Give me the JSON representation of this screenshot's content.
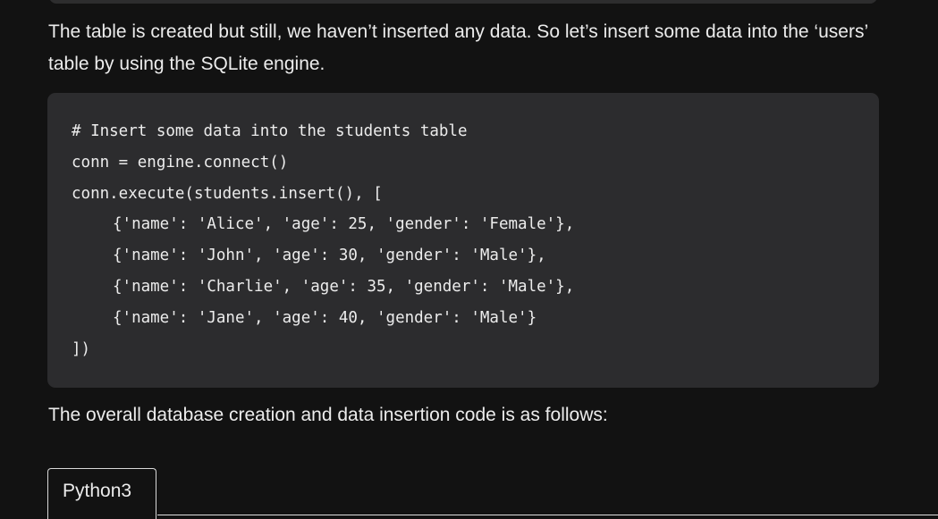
{
  "intro_paragraph": "The table is created but still, we haven’t inserted any data. So let’s insert some data into the ‘users’ table by using the SQLite engine.",
  "code_block": {
    "lines": [
      "# Insert some data into the students table",
      "conn = engine.connect()",
      "conn.execute(students.insert(), [",
      "{'name': 'Alice', 'age': 25, 'gender': 'Female'},",
      "{'name': 'John', 'age': 30, 'gender': 'Male'},",
      "{'name': 'Charlie', 'age': 35, 'gender': 'Male'},",
      "{'name': 'Jane', 'age': 40, 'gender': 'Male'}",
      "])"
    ]
  },
  "outro_paragraph": "The overall database creation and data insertion code is as follows:",
  "code_tabs": [
    {
      "label": "Python3"
    }
  ]
}
